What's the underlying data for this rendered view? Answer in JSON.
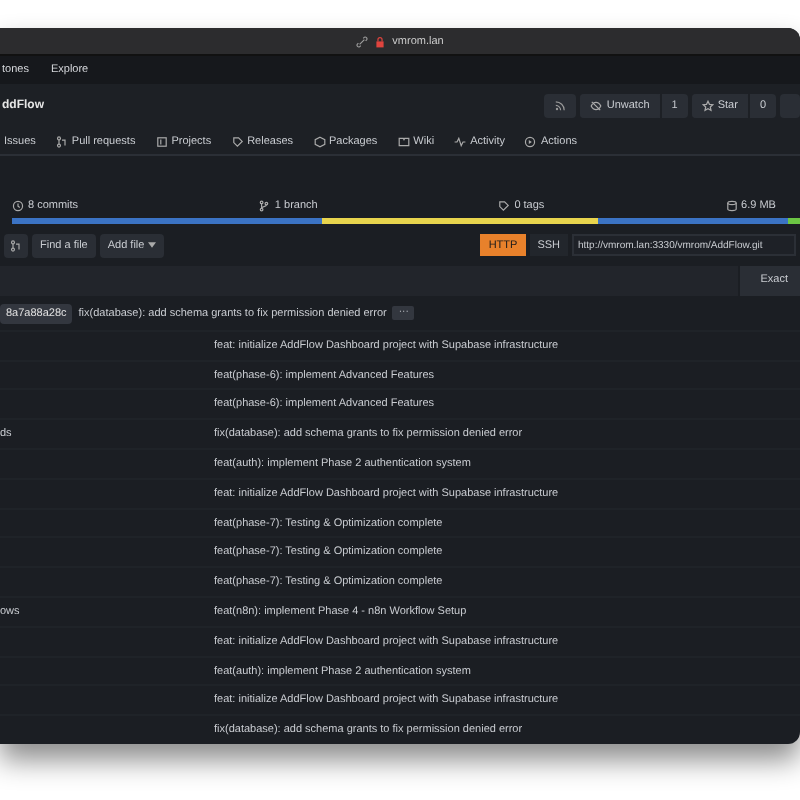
{
  "browser": {
    "address": "vmrom.lan"
  },
  "nav": [
    "tones",
    "Explore"
  ],
  "repo": {
    "name": "ddFlow",
    "unwatch": "Unwatch",
    "watch_count": "1",
    "star": "Star",
    "star_count": "0"
  },
  "tabs": [
    {
      "label": "Issues",
      "selected": false
    },
    {
      "label": "Pull requests",
      "selected": false
    },
    {
      "label": "Projects",
      "selected": false
    },
    {
      "label": "Releases",
      "selected": false
    },
    {
      "label": "Packages",
      "selected": false
    },
    {
      "label": "Wiki",
      "selected": false
    },
    {
      "label": "Activity",
      "selected": false
    },
    {
      "label": "Actions",
      "selected": false
    }
  ],
  "stats": [
    "8 commits",
    "1 branch",
    "0 tags",
    "6.9 MB"
  ],
  "language_bar": [
    {
      "color": "#3b73c4"
    },
    {
      "color": "#e8d44d"
    },
    {
      "color": "#3b73c4"
    },
    {
      "color": "#6cc644"
    }
  ],
  "toolbar": {
    "find": "Find a file",
    "add": "Add file",
    "clone_tabs": [
      {
        "label": "HTTP",
        "selected": true
      },
      {
        "label": "SSH",
        "selected": false
      }
    ],
    "clone_url": "http://vmrom.lan:3330/vmrom/AddFlow.git"
  },
  "search": {
    "mode": "Exact"
  },
  "latest_commit": {
    "sha": "8a7a88a28c",
    "message": "fix(database): add schema grants to fix permission denied error",
    "more": "···"
  },
  "files": [
    {
      "message": "feat: initialize AddFlow Dashboard project with Supabase infrastructure"
    },
    {
      "message": "feat(phase-6): implement Advanced Features"
    },
    {
      "message": "feat(phase-6): implement Advanced Features"
    },
    {
      "name": "ds",
      "message": "fix(database): add schema grants to fix permission denied error"
    },
    {
      "message": "feat(auth): implement Phase 2 authentication system"
    },
    {
      "message": "feat: initialize AddFlow Dashboard project with Supabase infrastructure"
    },
    {
      "message": "feat(phase-7): Testing & Optimization complete"
    },
    {
      "message": "feat(phase-7): Testing & Optimization complete"
    },
    {
      "message": "feat(phase-7): Testing & Optimization complete"
    },
    {
      "name": "ows",
      "message": "feat(n8n): implement Phase 4 - n8n Workflow Setup"
    },
    {
      "message": "feat: initialize AddFlow Dashboard project with Supabase infrastructure"
    },
    {
      "message": "feat(auth): implement Phase 2 authentication system"
    },
    {
      "message": "feat: initialize AddFlow Dashboard project with Supabase infrastructure"
    },
    {
      "message": "fix(database): add schema grants to fix permission denied error"
    }
  ]
}
